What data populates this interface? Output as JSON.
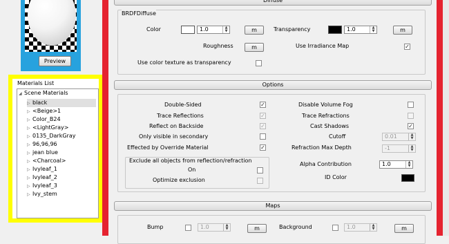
{
  "preview": {
    "button_label": "Preview"
  },
  "materials": {
    "title": "Materials List",
    "root_label": "Scene Materials",
    "items": [
      "black",
      "<Beige>1",
      "Color_B24",
      "<LightGray>",
      "0135_DarkGray",
      "96,96,96",
      "jean blue",
      "<Charcoal>",
      "Ivyleaf_1",
      "Ivyleaf_2",
      "Ivyleaf_3",
      "Ivy_stem"
    ]
  },
  "diffuse": {
    "section_title": "Diffuse",
    "group_title": "BRDFDiffuse",
    "color_label": "Color",
    "color_value": "1.0",
    "color_swatch": "#ffffff",
    "transparency_label": "Transparency",
    "transparency_value": "1.0",
    "transparency_swatch": "#000000",
    "map_button": "m",
    "roughness_label": "Roughness",
    "irradiance_label": "Use Irradiance Map",
    "use_color_texture_label": "Use color texture as transparency"
  },
  "options": {
    "section_title": "Options",
    "double_sided": "Double-Sided",
    "trace_reflections": "Trace Reflections",
    "reflect_backside": "Reflect on Backside",
    "only_visible_secondary": "Only visible in secondary",
    "effected_override": "Effected by Override Material",
    "disable_volume_fog": "Disable Volume Fog",
    "trace_refractions": "Trace Refractions",
    "cast_shadows": "Cast Shadows",
    "cutoff_label": "Cutoff",
    "cutoff_value": "0.01",
    "refraction_depth_label": "Refraction Max Depth",
    "refraction_depth_value": "-1",
    "alpha_label": "Alpha Contribution",
    "alpha_value": "1.0",
    "id_color_label": "ID Color",
    "id_color": "#000000",
    "exclude_title": "Exclude all objects from reflection/refraction",
    "exclude_on": "On",
    "optimize_exclusion": "Optimize exclusion"
  },
  "maps": {
    "section_title": "Maps",
    "bump_label": "Bump",
    "bump_value": "1.0",
    "background_label": "Background",
    "background_value": "1.0",
    "map_button": "m"
  },
  "colors": {
    "accent_red": "#e52330",
    "highlight_yellow": "#ffff00",
    "preview_blue": "#27a2de"
  }
}
